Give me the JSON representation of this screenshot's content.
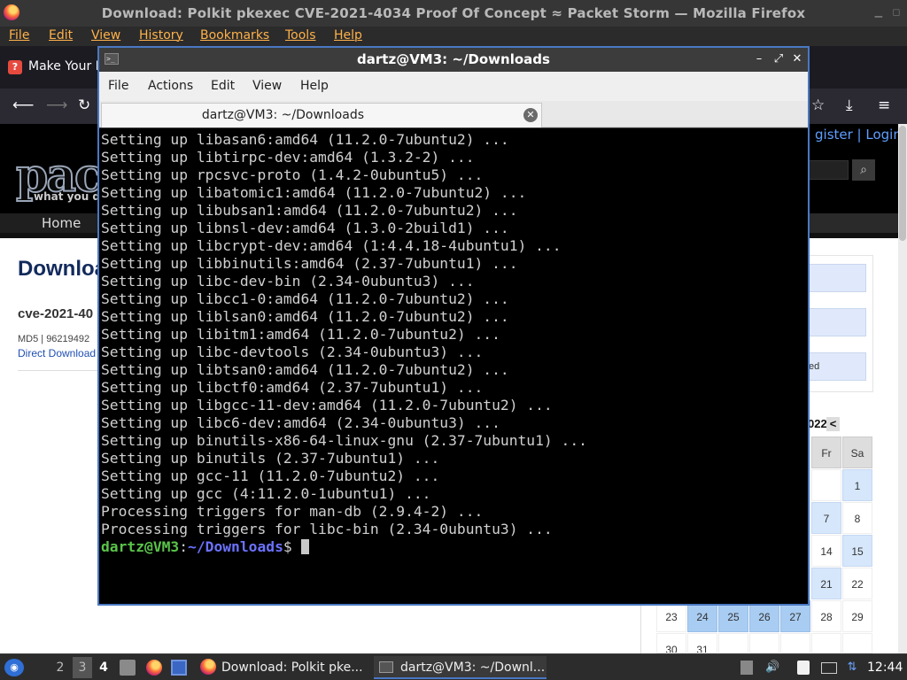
{
  "firefox": {
    "window_title": "Download: Polkit pkexec CVE-2021-4034 Proof Of Concept ≈ Packet Storm — Mozilla Firefox",
    "menu": [
      "File",
      "Edit",
      "View",
      "History",
      "Bookmarks",
      "Tools",
      "Help"
    ],
    "tab_label": "Make Your P",
    "page": {
      "logo_text": "pack",
      "tagline": "what you do",
      "register_text": "gister | Login",
      "nav_home": "Home",
      "heading": "Downloa",
      "cve_title": "cve-2021-40",
      "md5_text": "MD5 | 96219492",
      "direct_download": "Direct Download",
      "side_box_text": "ed",
      "calendar": {
        "title": "022",
        "prev": "<",
        "headers": [
          "Fr",
          "Sa"
        ],
        "rows": [
          [
            "",
            "1"
          ],
          [
            "7",
            "8"
          ],
          [
            "14",
            "15"
          ],
          [
            "21",
            "22"
          ]
        ],
        "bottom_row": [
          "23",
          "24",
          "25",
          "26",
          "27",
          "28",
          "29"
        ],
        "last_row": [
          "30",
          "31"
        ]
      }
    }
  },
  "terminal": {
    "title": "dartz@VM3: ~/Downloads",
    "menu": [
      "File",
      "Actions",
      "Edit",
      "View",
      "Help"
    ],
    "tab_label": "dartz@VM3: ~/Downloads",
    "lines": [
      "Setting up libasan6:amd64 (11.2.0-7ubuntu2) ...",
      "Setting up libtirpc-dev:amd64 (1.3.2-2) ...",
      "Setting up rpcsvc-proto (1.4.2-0ubuntu5) ...",
      "Setting up libatomic1:amd64 (11.2.0-7ubuntu2) ...",
      "Setting up libubsan1:amd64 (11.2.0-7ubuntu2) ...",
      "Setting up libnsl-dev:amd64 (1.3.0-2build1) ...",
      "Setting up libcrypt-dev:amd64 (1:4.4.18-4ubuntu1) ...",
      "Setting up libbinutils:amd64 (2.37-7ubuntu1) ...",
      "Setting up libc-dev-bin (2.34-0ubuntu3) ...",
      "Setting up libcc1-0:amd64 (11.2.0-7ubuntu2) ...",
      "Setting up liblsan0:amd64 (11.2.0-7ubuntu2) ...",
      "Setting up libitm1:amd64 (11.2.0-7ubuntu2) ...",
      "Setting up libc-devtools (2.34-0ubuntu3) ...",
      "Setting up libtsan0:amd64 (11.2.0-7ubuntu2) ...",
      "Setting up libctf0:amd64 (2.37-7ubuntu1) ...",
      "Setting up libgcc-11-dev:amd64 (11.2.0-7ubuntu2) ...",
      "Setting up libc6-dev:amd64 (2.34-0ubuntu3) ...",
      "Setting up binutils-x86-64-linux-gnu (2.37-7ubuntu1) ...",
      "Setting up binutils (2.37-7ubuntu1) ...",
      "Setting up gcc-11 (11.2.0-7ubuntu2) ...",
      "Setting up gcc (4:11.2.0-1ubuntu1) ...",
      "Processing triggers for man-db (2.9.4-2) ...",
      "Processing triggers for libc-bin (2.34-0ubuntu3) ..."
    ],
    "prompt_user": "dartz@VM3",
    "prompt_sep": ":",
    "prompt_path": "~/Downloads",
    "prompt_symbol": "$ "
  },
  "taskbar": {
    "workspaces": [
      "2",
      "3",
      "4"
    ],
    "tasks": [
      "Download: Polkit pke...",
      "dartz@VM3: ~/Downl..."
    ],
    "clock": "12:44"
  },
  "colors": {
    "terminal_border": "#4a78c2",
    "prompt_user": "#5ac44a",
    "prompt_path": "#6b72ff",
    "link_blue": "#1f4fb3"
  }
}
